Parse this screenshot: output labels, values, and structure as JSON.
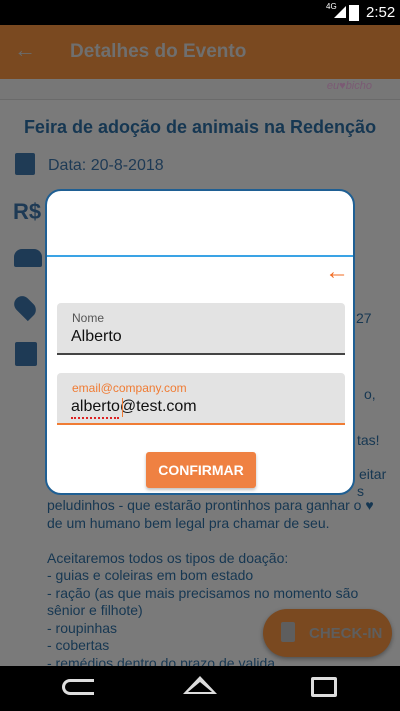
{
  "status_bar": {
    "network": "4G",
    "time": "2:52",
    "icons": [
      "signal-icon",
      "battery-icon"
    ]
  },
  "app_bar": {
    "back_icon": "arrow-left-icon",
    "title": "Detalhes do Evento"
  },
  "banner": {
    "logo_text": "eu♥bicho"
  },
  "event": {
    "title": "Feira de adoção de animais na Redenção",
    "date_label": "Data: 20-8-2018",
    "price_icon_text": "R$",
    "side_fragments": [
      "27",
      "o,",
      "tas!",
      "eitar",
      "s"
    ],
    "description": "peludinhos - que estarão prontinhos para ganhar o ♥ de um humano bem legal pra chamar de seu.\n\nAceitaremos todos os tipos de doação:\n- guias e coleiras em bom estado\n- ração (as que mais precisamos no momento são sênior e filhote)\n- roupinhas\n- cobertas\n- remédios dentro do prazo de valida"
  },
  "checkin_button": {
    "label": "CHECK-IN",
    "icon": "checkin-icon"
  },
  "dialog": {
    "back_icon": "arrow-left-icon",
    "name_field": {
      "label": "Nome",
      "value": "Alberto"
    },
    "email_field": {
      "placeholder": "email@company.com",
      "value": "alberto@test.com"
    },
    "confirm_label": "CONFIRMAR"
  },
  "colors": {
    "accent": "#ef8142",
    "dialog_border": "#1f5f93",
    "dialog_line": "#3aa3e5",
    "text_dark": "#163752"
  },
  "nav_bar": {
    "icons": [
      "back-nav-icon",
      "home-nav-icon",
      "recents-nav-icon"
    ]
  }
}
